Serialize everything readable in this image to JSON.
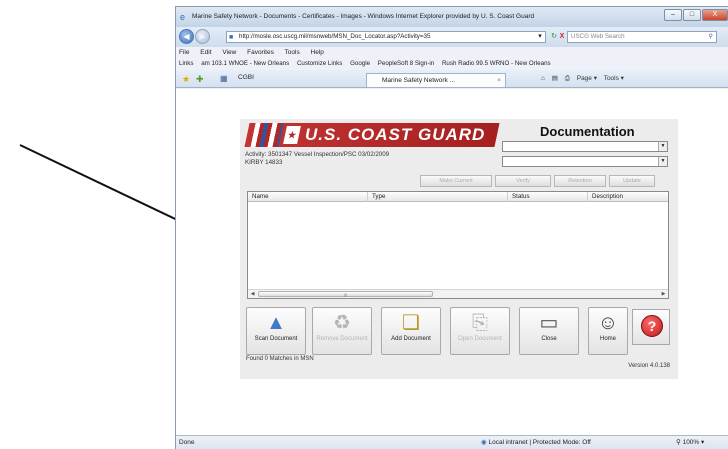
{
  "window": {
    "title": "Marine Safety Network - Documents - Certificates - Images - Windows Internet Explorer provided by U. S. Coast Guard",
    "min": "–",
    "max": "□",
    "close": "X"
  },
  "address": {
    "url": "http://mosle.osc.uscg.mil/msnweb/MSN_Doc_Locator.asp?Activity=35",
    "search_placeholder": "USCG Web Search",
    "refresh": "↻",
    "stop": "X"
  },
  "menu": [
    "File",
    "Edit",
    "View",
    "Favorites",
    "Tools",
    "Help"
  ],
  "links": {
    "label": "Links",
    "items": [
      "am 103.1 WNOE - New Orleans",
      "Customize Links",
      "Google",
      "PeopleSoft 8 Sign-in",
      "Rush Radio 99.5 WRNO - New Orleans"
    ]
  },
  "tabs": {
    "home": "CGBI",
    "active": "Marine Safety Network ...",
    "close": "×",
    "tools": [
      "Page ▾",
      "Tools ▾"
    ]
  },
  "app": {
    "banner": "U.S. COAST GUARD",
    "doc_title": "Documentation",
    "activity_line": "Activity: 3501347   Vessel Inspection/PSC   03/02/2009",
    "vessel_line": "KIRBY 14833",
    "small_buttons": [
      "Make Current",
      "Verify",
      "Retention",
      "Update"
    ],
    "columns": [
      "Name",
      "Type",
      "Status",
      "Description"
    ],
    "buttons": {
      "scan": "Scan Document",
      "remove": "Remove Document",
      "add": "Add Document",
      "open": "Open Document",
      "close": "Close",
      "home": "Home",
      "help": "?"
    },
    "found": "Found 0 Matches in MSN",
    "version": "Version 4.0.138"
  },
  "status": {
    "left": "Done",
    "zone": "Local intranet | Protected Mode: Off",
    "zoom": "100%"
  },
  "colors": {
    "banner_red": "#b42626",
    "banner_blue": "#2f55a0",
    "ie_chrome": "#d5e1ef"
  }
}
